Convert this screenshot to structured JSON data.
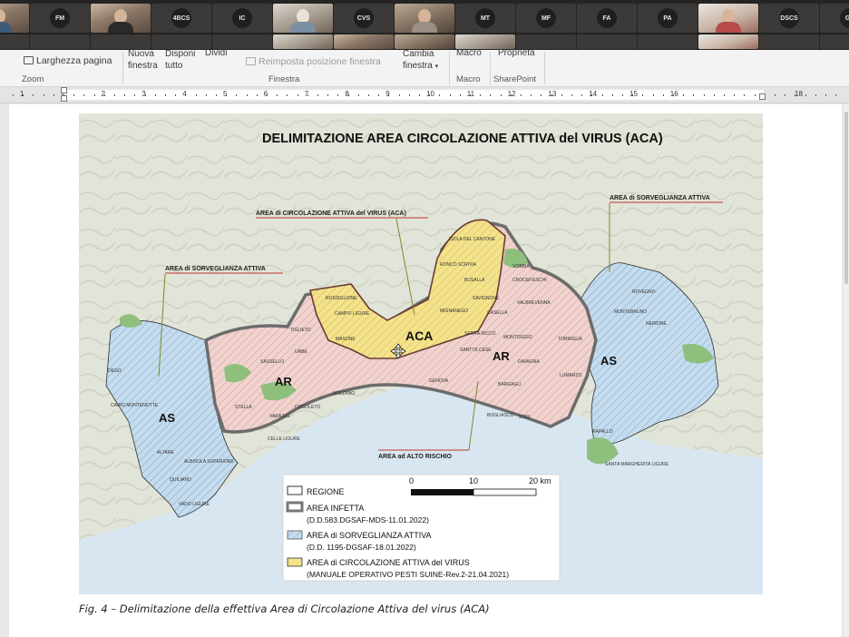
{
  "call_strip": {
    "participants": [
      {
        "initials": ""
      },
      {
        "initials": "FM"
      },
      {
        "initials": ""
      },
      {
        "initials": "4BCS"
      },
      {
        "initials": "IC"
      },
      {
        "initials": ""
      },
      {
        "initials": "CVS"
      },
      {
        "initials": ""
      },
      {
        "initials": "MT"
      },
      {
        "initials": "MF"
      },
      {
        "initials": "FA"
      },
      {
        "initials": "PA"
      },
      {
        "initials": ""
      },
      {
        "initials": "DSCS"
      },
      {
        "initials": "GC"
      }
    ]
  },
  "ribbon": {
    "zoom_group": {
      "page_width_label": "Larghezza pagina",
      "group_label": "Zoom"
    },
    "window_group": {
      "new_window_label": "Nuova finestra",
      "arrange_all_label": "Disponi tutto",
      "split_label": "Dividi",
      "reset_position_label": "Reimposta posizione finestra",
      "switch_window_label": "Cambia finestra",
      "group_label": "Finestra"
    },
    "macro_group": {
      "macro_label": "Macro",
      "group_label": "Macro"
    },
    "sharepoint_group": {
      "properties_label": "Proprietà",
      "group_label": "SharePoint"
    }
  },
  "ruler": {
    "numbers": [
      "1",
      "1",
      "2",
      "3",
      "4",
      "5",
      "6",
      "7",
      "8",
      "9",
      "10",
      "11",
      "12",
      "13",
      "14",
      "15",
      "16",
      "18"
    ]
  },
  "figure": {
    "map_title": "DELIMITAZIONE AREA CIRCOLAZIONE ATTIVA del VIRUS (ACA)",
    "callouts": {
      "aca": "AREA di CIRCOLAZIONE ATTIVA del VIRUS (ACA)",
      "sorv_left": "AREA di SORVEGLIANZA ATTIVA",
      "sorv_right": "AREA di SORVEGLIANZA ATTIVA",
      "alto_rischio": "AREA ad ALTO RISCHIO"
    },
    "zone_labels": {
      "aca": "ACA",
      "ar_west": "AR",
      "ar_east": "AR",
      "as_west": "AS",
      "as_east": "AS"
    },
    "places": [
      "ISOLA DEL CANTONE",
      "RONCO SCRIVIA",
      "BUSALLA",
      "VOBBIA",
      "CROCEFIESCHI",
      "ROSSIGLIONE",
      "CAMPO LIGURE",
      "SAVIGNONE",
      "VALBREVENNA",
      "MIGNANEGO",
      "CASELLA",
      "MASONE",
      "SERRA RICCO",
      "MONTOGGIO",
      "TORRIGLIA",
      "TIGLIETO",
      "URBE",
      "SANT'OLCESE",
      "DAVAGNA",
      "SASSELLO",
      "GENOVA",
      "LUMARZO",
      "BARGAGLI",
      "AREZANO",
      "BOGLIASCO",
      "SORI",
      "STELLA",
      "COGOLETO",
      "VARAZZE",
      "CELLE LIGURE",
      "ALBISOLA SUPERIORE",
      "QUILIANO",
      "VADO LIGURE",
      "ALTARE",
      "CAIRO MONTENOTTE",
      "DEGO",
      "ROVEGNO",
      "MONTEBRUNO",
      "NEIRONE",
      "RAPALLO",
      "SANTA MARGHERITA LIGURE"
    ],
    "scale": {
      "ticks": [
        "0",
        "10",
        "20 km"
      ]
    },
    "legend": [
      {
        "label": "REGIONE"
      },
      {
        "label": "AREA INFETTA",
        "sub": "(D.D.583.DGSAF-MDS-11.01.2022)"
      },
      {
        "label": "AREA di SORVEGLIANZA ATTIVA",
        "sub": "(D.D. 1195-DGSAF-18.01.2022)"
      },
      {
        "label": "AREA di CIRCOLAZIONE ATTIVA del VIRUS",
        "sub": "(MANUALE OPERATIVO PESTI SUINE-Rev.2-21.04.2021)"
      }
    ],
    "caption": "Fig. 4  – Delimitazione della effettiva Area di Circolazione Attiva del virus (ACA)"
  },
  "colors": {
    "aca_fill": "#f3e38a",
    "ar_fill": "#efc9c3",
    "as_fill": "#bcd6ea",
    "sea": "#d9e7f3",
    "land": "#e3e6dc"
  }
}
